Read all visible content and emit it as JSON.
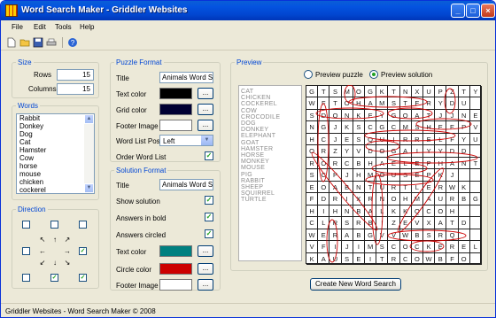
{
  "window": {
    "title": "Word Search Maker - Griddler Websites"
  },
  "menu": [
    "File",
    "Edit",
    "Tools",
    "Help"
  ],
  "size": {
    "legend": "Size",
    "rows_label": "Rows",
    "rows": "15",
    "columns_label": "Columns",
    "columns": "15"
  },
  "words": {
    "legend": "Words",
    "items": [
      "Rabbit",
      "Donkey",
      "Dog",
      "Cat",
      "Hamster",
      "Cow",
      "horse",
      "mouse",
      "chicken",
      "cockerel"
    ]
  },
  "direction": {
    "legend": "Direction"
  },
  "puzzle_format": {
    "legend": "Puzzle Format",
    "title_label": "Title",
    "title_value": "Animals Word Sea",
    "text_color_label": "Text color",
    "text_color": "#000000",
    "grid_color_label": "Grid color",
    "grid_color": "#000033",
    "footer_image_label": "Footer Image",
    "word_list_pos_label": "Word List Pos",
    "word_list_pos": "Left",
    "order_label": "Order Word List"
  },
  "solution_format": {
    "legend": "Solution Format",
    "title_label": "Title",
    "title_value": "Animals Word Sea",
    "show_solution_label": "Show solution",
    "answers_bold_label": "Answers in bold",
    "answers_circled_label": "Answers circled",
    "text_color_label": "Text color",
    "text_color": "#008080",
    "circle_color_label": "Circle color",
    "circle_color": "#cc0000",
    "footer_image_label": "Footer Image"
  },
  "preview": {
    "legend": "Preview",
    "radio_puzzle": "Preview puzzle",
    "radio_solution": "Preview solution",
    "word_list": [
      "CAT",
      "CHICKEN",
      "COCKEREL",
      "COW",
      "CROCODILE",
      "DOG",
      "DONKEY",
      "ELEPHANT",
      "GOAT",
      "HAMSTER",
      "HORSE",
      "MONKEY",
      "MOUSE",
      "PIG",
      "RABBIT",
      "SHEEP",
      "SQUIRREL",
      "TURTLE"
    ],
    "grid": [
      "GTSMOGKTNXUPZTY",
      "WFTOHAMSTERYDU",
      "SDONKEYGOATJJNE",
      "NGJKSCGCMSHEEPV",
      "HCJESQUIRRELFYU",
      "ORZYVDOGAIYYDD",
      "RORCBHAELEPHANT",
      "SCPJHMOUSEPKJ",
      "EOABNTURTLERWK",
      "FDRIXRNOHMAURBG",
      "HIHNBALKKQCOH",
      "CLRSRBIZEVXATD",
      "WERABGVVWBSRQ",
      "VFIJIMSCOCKEREL",
      "KAUSEITRCOWBFO"
    ],
    "create_button": "Create New Word Search"
  },
  "status": "Griddler Websites - Word Search Maker © 2008",
  "colors": {
    "accent": "#0046d5",
    "circle": "#cc0000",
    "solution_text": "#008080"
  }
}
